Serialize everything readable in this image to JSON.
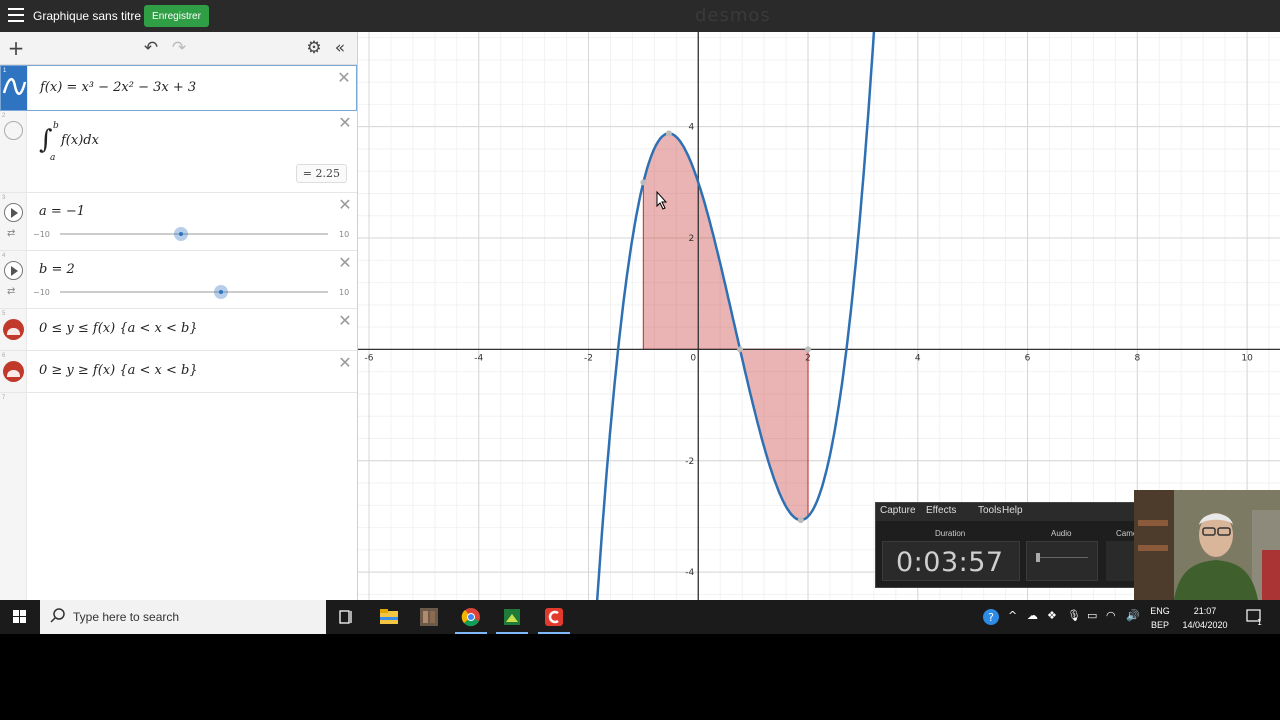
{
  "topbar": {
    "title": "Graphique sans titre",
    "save_label": "Enregistrer",
    "brand": "desmos"
  },
  "expressions": [
    {
      "index": "1",
      "latex": "f(x) = x³ − 2x² − 3x + 3",
      "color": "#2d70b3"
    },
    {
      "index": "2",
      "latex": "f(x)dx",
      "lower": "a",
      "upper": "b",
      "result": "= 2.25"
    },
    {
      "index": "3",
      "latex": "a = −1",
      "slider": {
        "min": "−10",
        "max": "10",
        "value": -1
      }
    },
    {
      "index": "4",
      "latex": "b = 2",
      "slider": {
        "min": "−10",
        "max": "10",
        "value": 2
      }
    },
    {
      "index": "5",
      "latex": "0 ≤ y ≤ f(x) {a < x < b}",
      "color": "#c74440"
    },
    {
      "index": "6",
      "latex": "0 ≥ y ≥ f(x) {a < x < b}",
      "color": "#c74440"
    },
    {
      "index": "7"
    }
  ],
  "graph": {
    "x_range": [
      -6.2,
      10.6
    ],
    "y_range": [
      -4.5,
      5.7
    ],
    "x_ticks": [
      "-6",
      "-4",
      "-2",
      "0",
      "2",
      "4",
      "6",
      "8",
      "10"
    ],
    "y_ticks": [
      "4",
      "2",
      "-2",
      "-4"
    ],
    "a": -1,
    "b": 2,
    "curve_color": "#2d70b3",
    "fill_color": "#c74440"
  },
  "recorder": {
    "menu": [
      "Capture",
      "Effects",
      "Tools",
      "Help"
    ],
    "duration_label": "Duration",
    "audio_label": "Audio",
    "camera_label": "Came",
    "time": "0:03:57"
  },
  "taskbar": {
    "search_placeholder": "Type here to search",
    "lang_top": "ENG",
    "lang_bottom": "BEP",
    "time": "21:07",
    "date": "14/04/2020",
    "notifications": "1"
  }
}
